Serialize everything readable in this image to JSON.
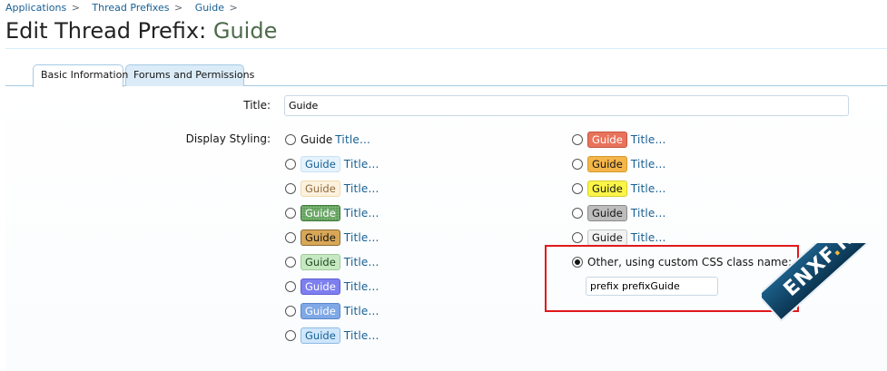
{
  "breadcrumb": [
    {
      "label": "Applications",
      "sep": ">"
    },
    {
      "label": "Thread Prefixes",
      "sep": ">"
    },
    {
      "label": "Guide",
      "sep": ">"
    }
  ],
  "page": {
    "title_prefix": "Edit Thread Prefix:",
    "title_name": "Guide"
  },
  "tabs": [
    {
      "label": "Basic Information",
      "active": true
    },
    {
      "label": "Forums and Permissions",
      "active": false
    }
  ],
  "form": {
    "title_label": "Title:",
    "title_value": "Guide",
    "display_styling_label": "Display Styling:",
    "sample_text": "Guide",
    "post_title_text": "Title...",
    "styles_left": [
      {
        "id": "plain",
        "checked": false
      },
      {
        "id": "lightblue",
        "checked": false
      },
      {
        "id": "cream",
        "checked": false
      },
      {
        "id": "darkgreen",
        "checked": false
      },
      {
        "id": "tan",
        "checked": false
      },
      {
        "id": "lightgreen",
        "checked": false
      },
      {
        "id": "purple",
        "checked": false
      },
      {
        "id": "skyblue",
        "checked": false
      },
      {
        "id": "paleblue",
        "checked": false
      }
    ],
    "styles_right": [
      {
        "id": "red",
        "checked": false
      },
      {
        "id": "orange",
        "checked": false
      },
      {
        "id": "yellow",
        "checked": false
      },
      {
        "id": "gray",
        "checked": false
      },
      {
        "id": "lightgray",
        "checked": false
      }
    ],
    "other_label": "Other, using custom CSS class name:",
    "other_checked": true,
    "custom_css_value": "prefix prefixGuide"
  },
  "watermark": {
    "part1": "ENXF",
    "dot": ".",
    "part2": "NET"
  },
  "colors": {
    "link": "#176093",
    "highlight_border": "#e0191c",
    "tab_border": "#a5cae4"
  }
}
